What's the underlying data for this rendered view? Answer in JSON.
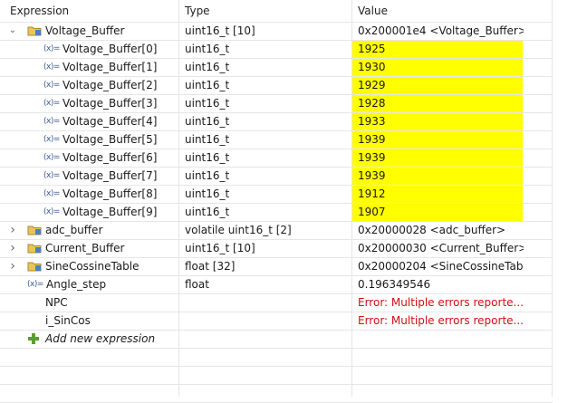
{
  "columns": {
    "expression": "Expression",
    "type": "Type",
    "value": "Value"
  },
  "rows": [
    {
      "name": "Voltage_Buffer",
      "type": "uint16_t [10]",
      "value": "0x200001e4 <Voltage_Buffer>",
      "kind": "folder",
      "twisty": "expanded",
      "indent": 0
    },
    {
      "name": "Voltage_Buffer[0]",
      "type": "uint16_t",
      "value": "1925",
      "kind": "var",
      "indent": 1,
      "changed": true
    },
    {
      "name": "Voltage_Buffer[1]",
      "type": "uint16_t",
      "value": "1930",
      "kind": "var",
      "indent": 1,
      "changed": true
    },
    {
      "name": "Voltage_Buffer[2]",
      "type": "uint16_t",
      "value": "1929",
      "kind": "var",
      "indent": 1,
      "changed": true
    },
    {
      "name": "Voltage_Buffer[3]",
      "type": "uint16_t",
      "value": "1928",
      "kind": "var",
      "indent": 1,
      "changed": true
    },
    {
      "name": "Voltage_Buffer[4]",
      "type": "uint16_t",
      "value": "1933",
      "kind": "var",
      "indent": 1,
      "changed": true
    },
    {
      "name": "Voltage_Buffer[5]",
      "type": "uint16_t",
      "value": "1939",
      "kind": "var",
      "indent": 1,
      "changed": true
    },
    {
      "name": "Voltage_Buffer[6]",
      "type": "uint16_t",
      "value": "1939",
      "kind": "var",
      "indent": 1,
      "changed": true
    },
    {
      "name": "Voltage_Buffer[7]",
      "type": "uint16_t",
      "value": "1939",
      "kind": "var",
      "indent": 1,
      "changed": true
    },
    {
      "name": "Voltage_Buffer[8]",
      "type": "uint16_t",
      "value": "1912",
      "kind": "var",
      "indent": 1,
      "changed": true
    },
    {
      "name": "Voltage_Buffer[9]",
      "type": "uint16_t",
      "value": "1907",
      "kind": "var",
      "indent": 1,
      "changed": true
    },
    {
      "name": "adc_buffer",
      "type": "volatile uint16_t [2]",
      "value": "0x20000028 <adc_buffer>",
      "kind": "folder",
      "twisty": "collapsed",
      "indent": 0
    },
    {
      "name": "Current_Buffer",
      "type": "uint16_t [10]",
      "value": "0x20000030 <Current_Buffer>",
      "kind": "folder",
      "twisty": "collapsed",
      "indent": 0
    },
    {
      "name": "SineCossineTable",
      "type": "float [32]",
      "value": "0x20000204 <SineCossineTab...",
      "kind": "folder",
      "twisty": "collapsed",
      "indent": 0
    },
    {
      "name": "Angle_step",
      "type": "float",
      "value": "0.196349546",
      "kind": "var",
      "indent": 0
    },
    {
      "name": "NPC",
      "type": "",
      "value": "Error: Multiple errors reporte...",
      "kind": "none",
      "indent": 0,
      "error": true
    },
    {
      "name": "i_SinCos",
      "type": "",
      "value": "Error: Multiple errors reporte...",
      "kind": "none",
      "indent": 0,
      "error": true
    },
    {
      "name": "Add new expression",
      "type": "",
      "value": "",
      "kind": "add",
      "indent": 0
    }
  ],
  "icons": {
    "var_icon_text": "(x)=",
    "expanded": "chevron-down-icon",
    "collapsed": "chevron-right-icon",
    "folder": "array-folder-icon",
    "add": "add-plus-icon"
  },
  "colors": {
    "changed_highlight": "#ffff00",
    "error_text": "#d01010"
  }
}
